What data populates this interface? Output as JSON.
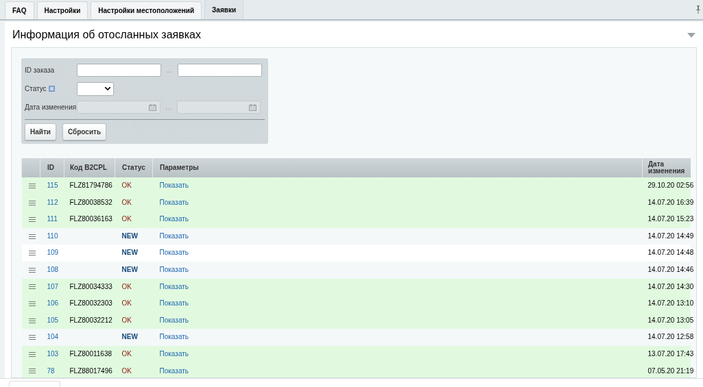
{
  "tabs": [
    {
      "label": "FAQ",
      "selected": false
    },
    {
      "label": "Настройки",
      "selected": false
    },
    {
      "label": "Настройки местоположений",
      "selected": false
    },
    {
      "label": "Заявки",
      "selected": true
    }
  ],
  "title": "Информация об отосланных заявках",
  "filter": {
    "fields": [
      {
        "kind": "range",
        "label": "ID заказа",
        "separator": "..."
      },
      {
        "kind": "select",
        "label": "Статус"
      },
      {
        "kind": "date-range",
        "label": "Дата изменения",
        "separator": "..."
      }
    ],
    "buttons": [
      "Найти",
      "Сбросить"
    ]
  },
  "table": {
    "columns": [
      "ID",
      "Код B2CPL",
      "Статус",
      "Параметры",
      "Дата изменения"
    ],
    "rows": [
      {
        "kind": "ok",
        "id": "115",
        "code": "FLZ81794786",
        "status": "OK",
        "params": "Показать",
        "date": "29.10.20 02:56"
      },
      {
        "kind": "ok",
        "id": "112",
        "code": "FLZ80038532",
        "status": "OK",
        "params": "Показать",
        "date": "14.07.20 16:39"
      },
      {
        "kind": "ok",
        "id": "111",
        "code": "FLZ80036163",
        "status": "OK",
        "params": "Показать",
        "date": "14.07.20 15:23"
      },
      {
        "kind": "new",
        "id": "110",
        "status": "NEW",
        "params": "Показать",
        "date": "14.07.20 14:49"
      },
      {
        "kind": "new",
        "id": "109",
        "status": "NEW",
        "params": "Показать",
        "date": "14.07.20 14:48"
      },
      {
        "kind": "new",
        "id": "108",
        "status": "NEW",
        "params": "Показать",
        "date": "14.07.20 14:46"
      },
      {
        "kind": "ok",
        "id": "107",
        "code": "FLZ80034333",
        "status": "OK",
        "params": "Показать",
        "date": "14.07.20 14:30"
      },
      {
        "kind": "ok",
        "id": "106",
        "code": "FLZ80032303",
        "status": "OK",
        "params": "Показать",
        "date": "14.07.20 13:10"
      },
      {
        "kind": "ok",
        "id": "105",
        "code": "FLZ80032212",
        "status": "OK",
        "params": "Показать",
        "date": "14.07.20 13:05"
      },
      {
        "kind": "new",
        "id": "104",
        "status": "NEW",
        "params": "Показать",
        "date": "14.07.20 12:58"
      },
      {
        "kind": "ok",
        "id": "103",
        "code": "FLZ80011638",
        "status": "OK",
        "params": "Показать",
        "date": "13.07.20 17:43"
      },
      {
        "kind": "ok",
        "id": "78",
        "code": "FLZ88017496",
        "status": "OK",
        "params": "Показать",
        "date": "07.05.20 21:19"
      }
    ]
  }
}
